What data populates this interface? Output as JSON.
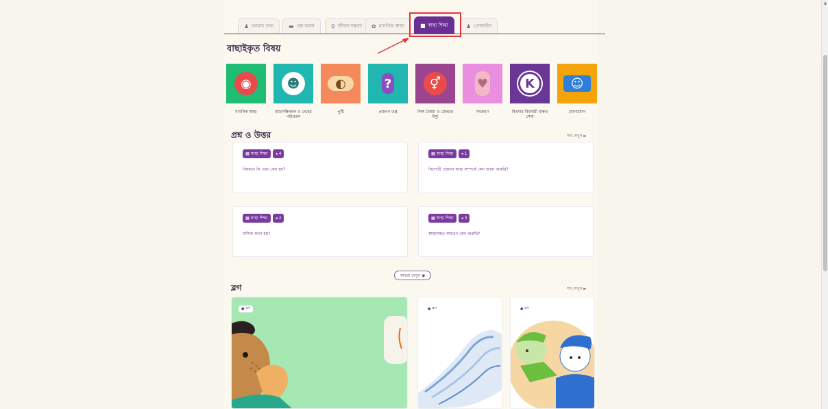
{
  "tabs": [
    {
      "icon": "person-icon",
      "glyph": "♟",
      "label": "আমার তথ্য",
      "active": false
    },
    {
      "icon": "chat-icon",
      "glyph": "▬",
      "label": "প্রশ্ন করুন",
      "active": false
    },
    {
      "icon": "lightbulb-icon",
      "glyph": "♀",
      "label": "জীবন দক্ষতা",
      "active": false
    },
    {
      "icon": "heart-icon",
      "glyph": "✿",
      "label": "মানসিক স্বাস্থ্য",
      "active": false
    },
    {
      "icon": "health-icon",
      "glyph": "■",
      "label": "স্বাস্থ্য শিক্ষা",
      "active": true
    },
    {
      "icon": "user-icon",
      "glyph": "♟",
      "label": "প্রোফাইল",
      "active": false
    }
  ],
  "featured": {
    "title": "বাছাইকৃত বিষয়",
    "topics": [
      {
        "label": "মানসিক স্বাস্থ্য",
        "bg": "#1ebd73",
        "icon": "brain-icon",
        "glyph": "◉"
      },
      {
        "label": "বয়ঃসন্ধিকাল ও দেহের পরিবর্তন",
        "bg": "#1fb7b0",
        "icon": "girl-icon",
        "glyph": "☻"
      },
      {
        "label": "পুষ্টি",
        "bg": "#f48a5b",
        "icon": "food-icon",
        "glyph": "◐"
      },
      {
        "label": "প্রজনন তন্ত্র",
        "bg": "#1fb7b0",
        "icon": "question-person-icon",
        "glyph": "?"
      },
      {
        "label": "লিঙ্গ বৈষম্য ও জেন্ডার ইস্যু",
        "bg": "#9b4590",
        "icon": "gender-icon",
        "glyph": "⚥"
      },
      {
        "label": "সংক্রমণ",
        "bg": "#ea8fe0",
        "icon": "body-icon",
        "glyph": "♥"
      },
      {
        "label": "কিশোর কিশোরী বান্ধব সেবা",
        "bg": "#6b3796",
        "icon": "clinic-icon",
        "glyph": "K"
      },
      {
        "label": "যোগাযোগ",
        "bg": "#f4a30b",
        "icon": "conversation-icon",
        "glyph": "☺"
      }
    ]
  },
  "qa": {
    "title": "প্রশ্ন ও উত্তর",
    "see_all": "সব দেখুন ►",
    "cards": [
      {
        "tag": "স্বাস্থ্য শিক্ষা",
        "count": "4",
        "question": "বিষন্নতা কি এবং কেন হয়?"
      },
      {
        "tag": "স্বাস্থ্য শিক্ষা",
        "count": "1",
        "question": "কিশোরী প্রজনন স্বাস্থ্য সম্পর্কে কেন জানা জরুরি?"
      },
      {
        "tag": "স্বাস্থ্য শিক্ষা",
        "count": "2",
        "question": "মাসিক কখন হয়?"
      },
      {
        "tag": "স্বাস্থ্য শিক্ষা",
        "count": "3",
        "question": "স্বাস্থ্যসম্মত আচরণ কেন জরুরি?"
      }
    ],
    "more": "আরো দেখুন ◉"
  },
  "media": {
    "title": "ব্লগ",
    "see_all": "সব দেখুন ►",
    "tag": "ব্লগ"
  },
  "colors": {
    "accent": "#6b2f93",
    "highlight": "#e0343c"
  }
}
